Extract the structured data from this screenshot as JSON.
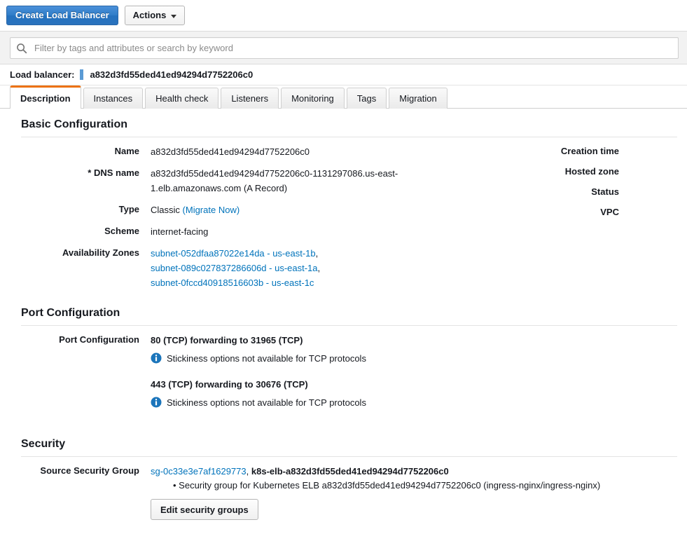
{
  "toolbar": {
    "create_button": "Create Load Balancer",
    "actions_button": "Actions"
  },
  "search": {
    "placeholder": "Filter by tags and attributes or search by keyword",
    "value": ""
  },
  "resource_header": {
    "label": "Load balancer:",
    "name": "a832d3fd55ded41ed94294d7752206c0"
  },
  "tabs": [
    {
      "label": "Description",
      "active": true
    },
    {
      "label": "Instances",
      "active": false
    },
    {
      "label": "Health check",
      "active": false
    },
    {
      "label": "Listeners",
      "active": false
    },
    {
      "label": "Monitoring",
      "active": false
    },
    {
      "label": "Tags",
      "active": false
    },
    {
      "label": "Migration",
      "active": false
    }
  ],
  "basic_configuration": {
    "title": "Basic Configuration",
    "name_label": "Name",
    "name_value": "a832d3fd55ded41ed94294d7752206c0",
    "dns_label": "* DNS name",
    "dns_value": "a832d3fd55ded41ed94294d7752206c0-1131297086.us-east-1.elb.amazonaws.com (A Record)",
    "type_label": "Type",
    "type_value": "Classic",
    "type_link": "(Migrate Now)",
    "scheme_label": "Scheme",
    "scheme_value": "internet-facing",
    "az_label": "Availability Zones",
    "availability_zones": [
      {
        "text": "subnet-052dfaa87022e14da - us-east-1b",
        "separator": ","
      },
      {
        "text": "subnet-089c027837286606d - us-east-1a",
        "separator": ","
      },
      {
        "text": "subnet-0fccd40918516603b - us-east-1c",
        "separator": ""
      }
    ],
    "creation_time_label": "Creation time",
    "creation_time_value": "",
    "hosted_zone_label": "Hosted zone",
    "hosted_zone_value": "",
    "status_label": "Status",
    "status_value": "",
    "vpc_label": "VPC",
    "vpc_value": ""
  },
  "port_configuration": {
    "title": "Port Configuration",
    "row_label": "Port Configuration",
    "entries": [
      {
        "forwarding": "80 (TCP) forwarding to 31965 (TCP)",
        "note": "Stickiness options not available for TCP protocols"
      },
      {
        "forwarding": "443 (TCP) forwarding to 30676 (TCP)",
        "note": "Stickiness options not available for TCP protocols"
      }
    ]
  },
  "security": {
    "title": "Security",
    "row_label": "Source Security Group",
    "group_id": "sg-0c33e3e7af1629773",
    "separator": ",",
    "group_name": "k8s-elb-a832d3fd55ded41ed94294d7752206c0",
    "description": "• Security group for Kubernetes ELB a832d3fd55ded41ed94294d7752206c0 (ingress-nginx/ingress-nginx)",
    "edit_button": "Edit security groups"
  },
  "colors": {
    "accent_orange": "#ec7211",
    "link_blue": "#0073bb",
    "primary_blue": "#2f7dc8",
    "info_blue": "#1b75bb"
  }
}
